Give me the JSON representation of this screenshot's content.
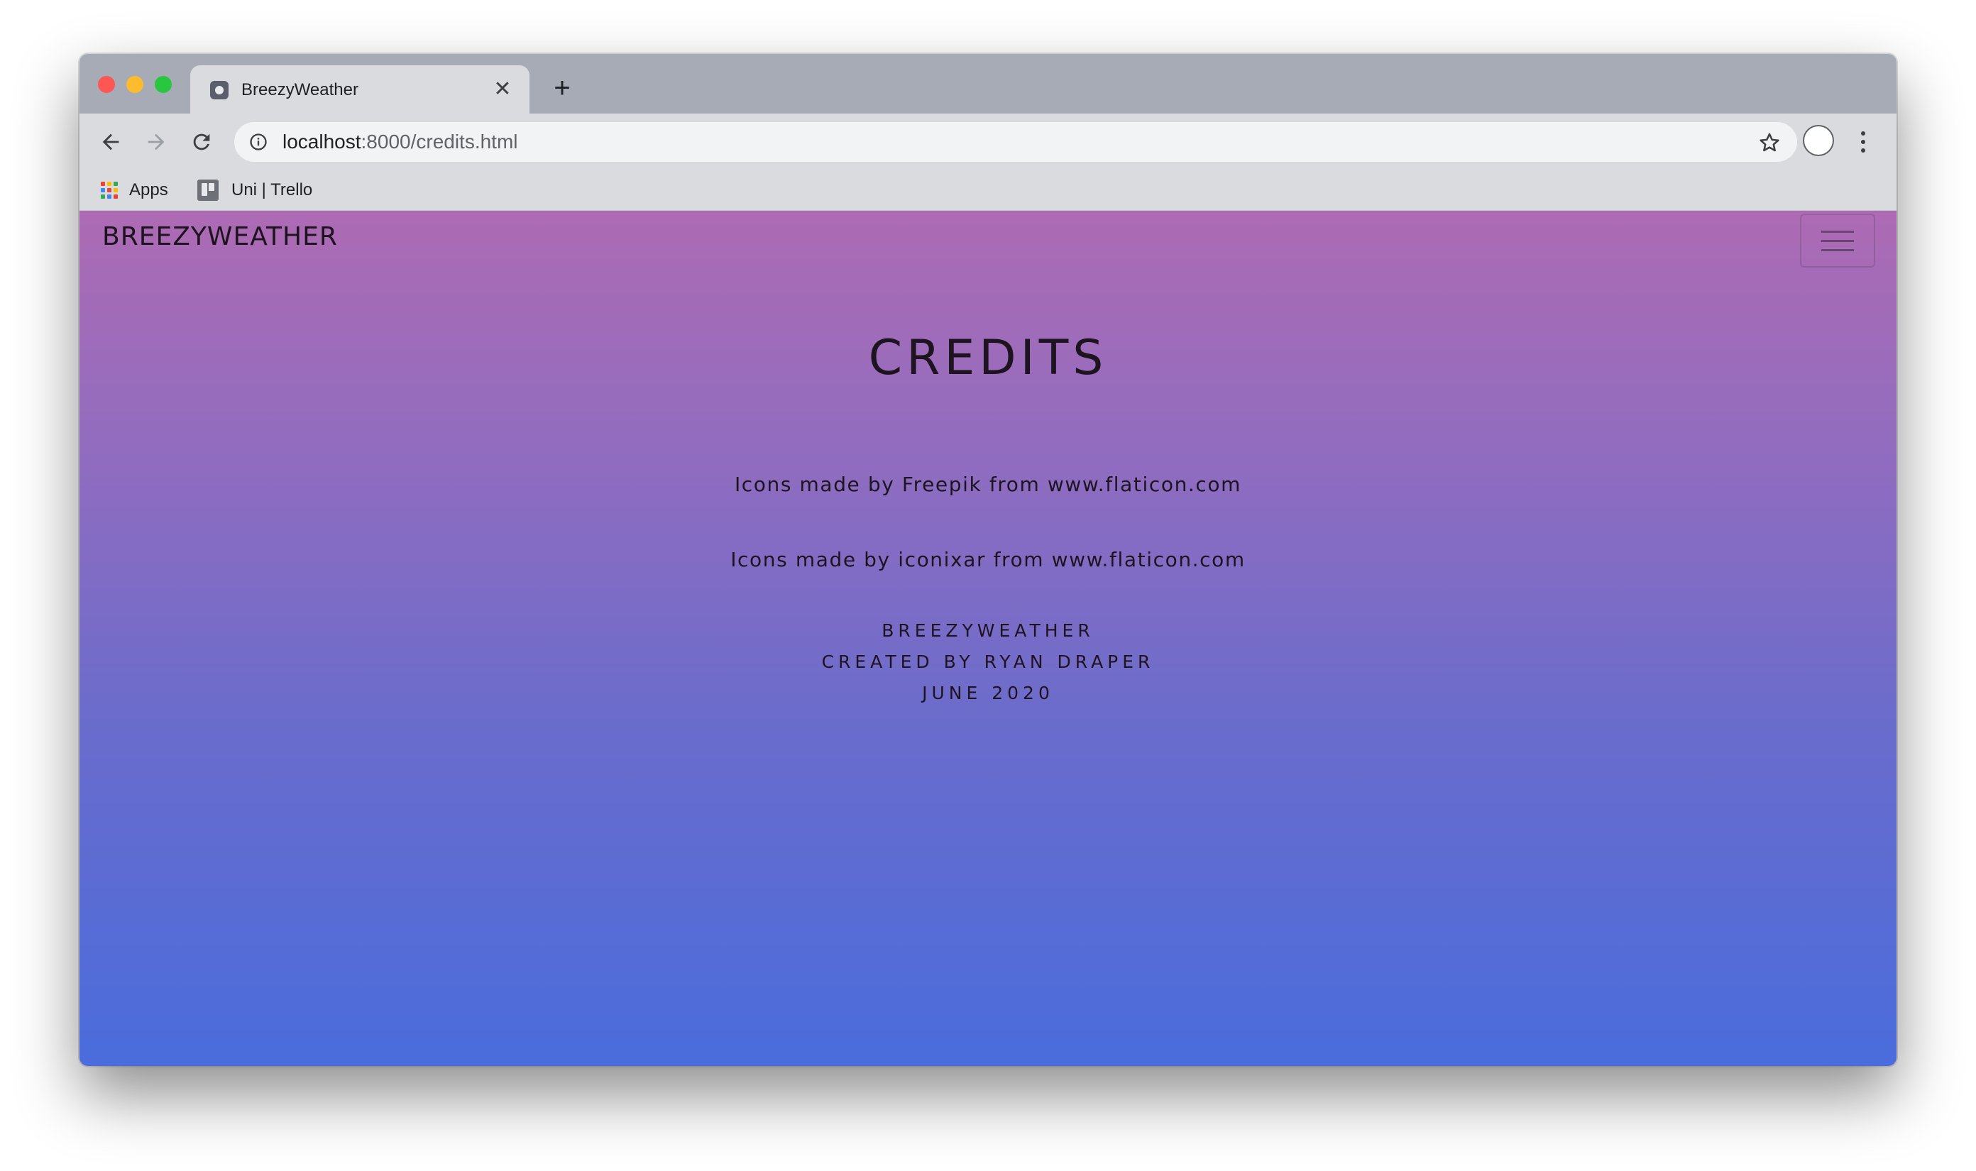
{
  "browser": {
    "tab": {
      "title": "BreezyWeather",
      "close_symbol": "✕",
      "new_tab_symbol": "+"
    },
    "address_bar": {
      "host": "localhost",
      "path": ":8000/credits.html"
    },
    "bookmarks": [
      {
        "label": "Apps",
        "icon": "apps-grid-icon"
      },
      {
        "label": "Uni | Trello",
        "icon": "trello-icon"
      }
    ]
  },
  "page": {
    "brand": "BREEZYWEATHER",
    "menu_icon": "hamburger-menu-icon",
    "heading": "CREDITS",
    "credits": [
      "Icons made by Freepik from www.flaticon.com",
      "Icons made by iconixar from www.flaticon.com"
    ],
    "footer": [
      "BREEZYWEATHER",
      "CREATED BY RYAN DRAPER",
      "JUNE 2020"
    ],
    "colors": {
      "gradient_top": "#ad6bb3",
      "gradient_bottom": "#4a6cdc",
      "text": "#1e1420"
    }
  }
}
